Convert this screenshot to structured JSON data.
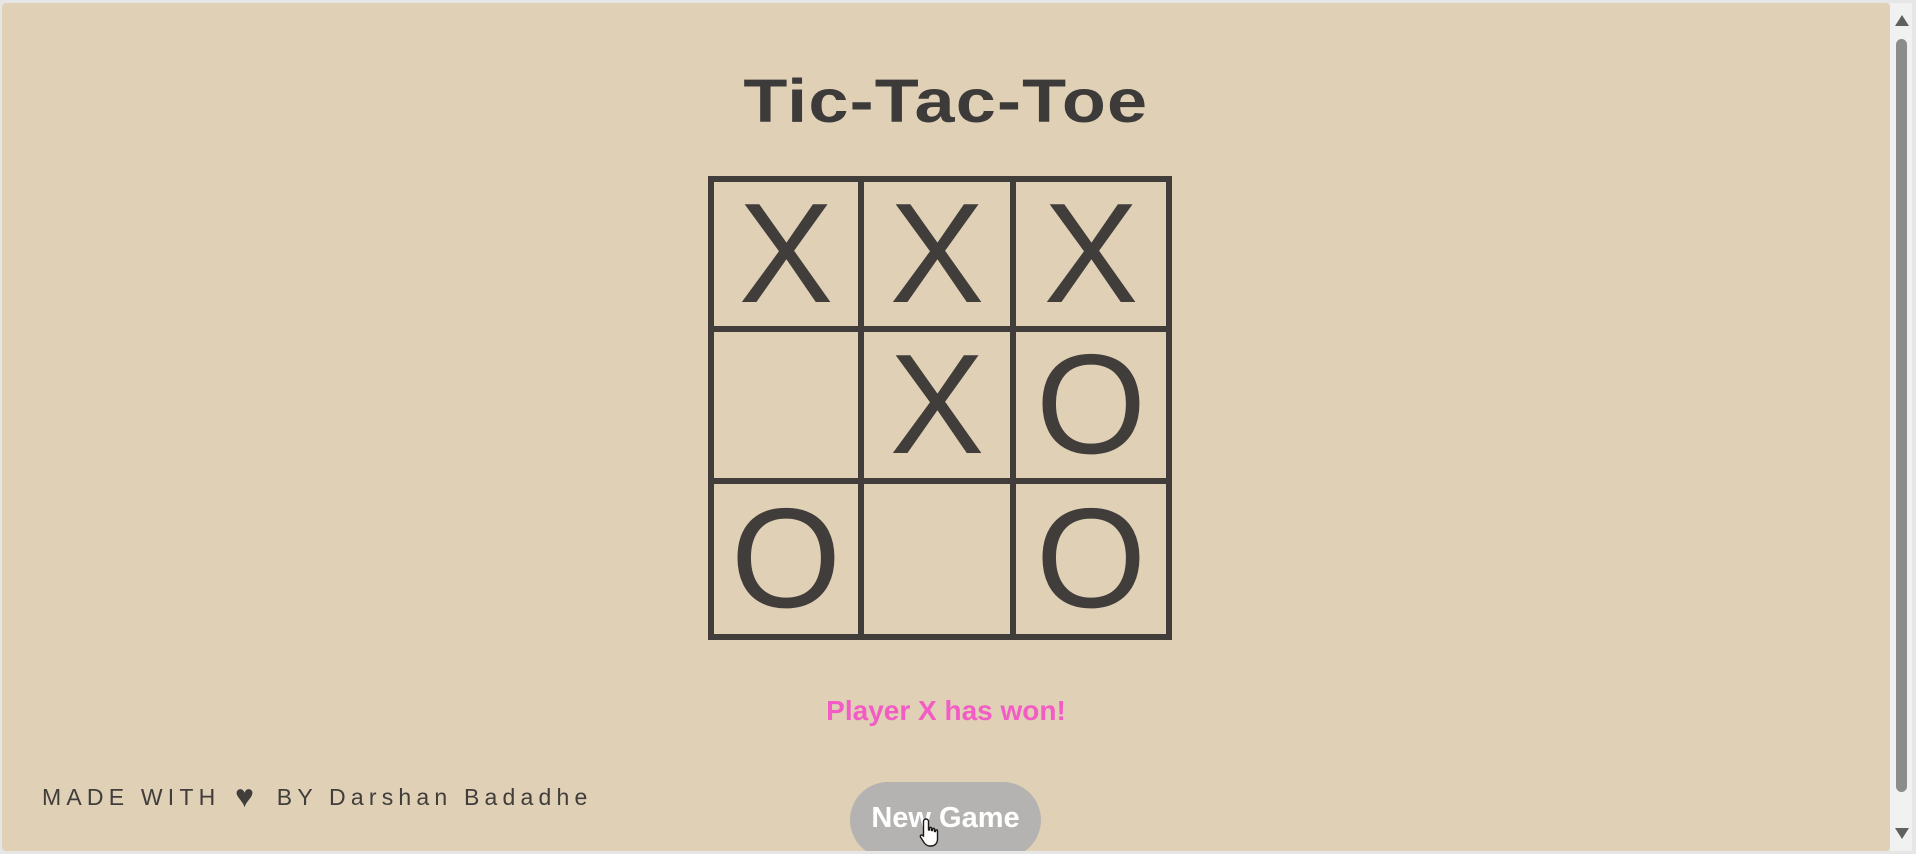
{
  "title": "Tic-Tac-Toe",
  "board": {
    "cells": [
      "X",
      "X",
      "X",
      "",
      "X",
      "O",
      "O",
      "",
      "O"
    ]
  },
  "status": "Player X has won!",
  "footer": {
    "before": "MADE WITH",
    "heart": "♥",
    "after": "BY Darshan Badadhe"
  },
  "new_game_label": "New Game",
  "colors": {
    "background": "#dfd0b6",
    "ink": "#403d3b",
    "status": "#f25cc4",
    "button": "#b4b3b1"
  }
}
